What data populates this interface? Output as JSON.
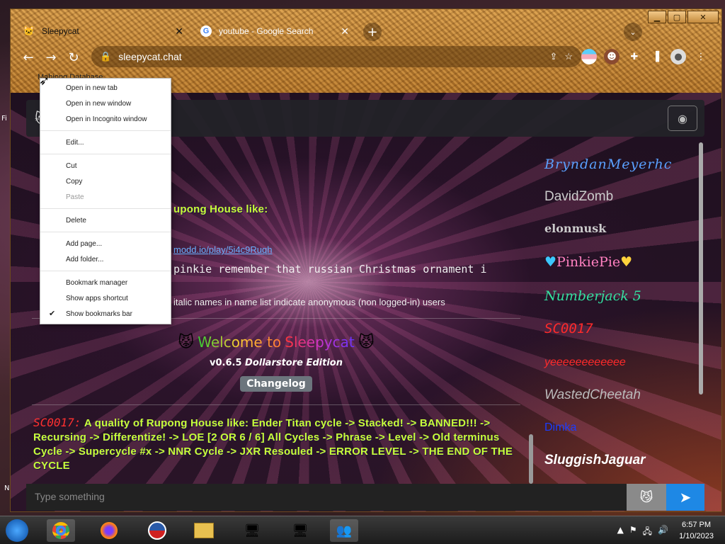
{
  "browser": {
    "tabs": [
      {
        "title": "Sleepycat",
        "favicon": "cat-icon"
      },
      {
        "title": "youtube - Google Search",
        "favicon": "google-icon"
      }
    ],
    "url": "sleepycat.chat",
    "bookmark_label": "Mahjong Database"
  },
  "context_menu": {
    "items": [
      {
        "label": "Open in new tab"
      },
      {
        "label": "Open in new window"
      },
      {
        "label": "Open in Incognito window"
      },
      {
        "label": "Edit..."
      },
      {
        "label": "Cut"
      },
      {
        "label": "Copy"
      },
      {
        "label": "Paste",
        "disabled": true
      },
      {
        "label": "Delete"
      },
      {
        "label": "Add page..."
      },
      {
        "label": "Add folder..."
      },
      {
        "label": "Bookmark manager"
      },
      {
        "label": "Show apps shortcut"
      },
      {
        "label": "Show bookmarks bar",
        "checked": true
      }
    ]
  },
  "chat": {
    "partial_heading": "upong House like:",
    "partial_link": "modd.io/play/5i4c9Ruqh",
    "partial_message": "pinkie remember that russian Christmas ornament i",
    "notice": "italic names in name list indicate anonymous (non logged-in) users",
    "welcome": {
      "prefix": "Welcome to",
      "brand": "Sleepycat",
      "version": "v0.6.5",
      "edition": "Dollarstore Edition",
      "changelog": "Changelog"
    },
    "last_message": {
      "user": "SC0017:",
      "text": "A quality of Rupong House like: Ender Titan cycle -> Stacked! -> BANNED!!! -> Recursing -> Differentize! -> LOE [2 OR 6 / 6] All Cycles -> Phrase -> Level -> Old terminus Cycle -> Supercycle #x -> NNR Cycle -> JXR Resouled -> ERROR LEVEL -> THE END OF THE CYCLE"
    },
    "input_placeholder": "Type something"
  },
  "namelist": [
    {
      "name": "BryndanMeyerhc",
      "color": "#5aa0ff"
    },
    {
      "name": "DavidZomb",
      "color": "#cccccc"
    },
    {
      "name": "elonmusk",
      "color": "#cccccc"
    },
    {
      "name": "PinkiePie",
      "color": "#ff80c0"
    },
    {
      "name": "Numberjack 5",
      "color": "#33e0a0"
    },
    {
      "name": "SC0017",
      "color": "#ff2a2a"
    },
    {
      "name": "yeeeeeeeeeeee",
      "color": "#ff2a2a"
    },
    {
      "name": "WastedCheetah",
      "color": "#bbbbbb"
    },
    {
      "name": "Dimka",
      "color": "#1a3cff"
    },
    {
      "name": "SluggishJaguar",
      "color": "#ffffff"
    }
  ],
  "desktop": {
    "clock_time": "6:57 PM",
    "clock_date": "1/10/2023"
  }
}
